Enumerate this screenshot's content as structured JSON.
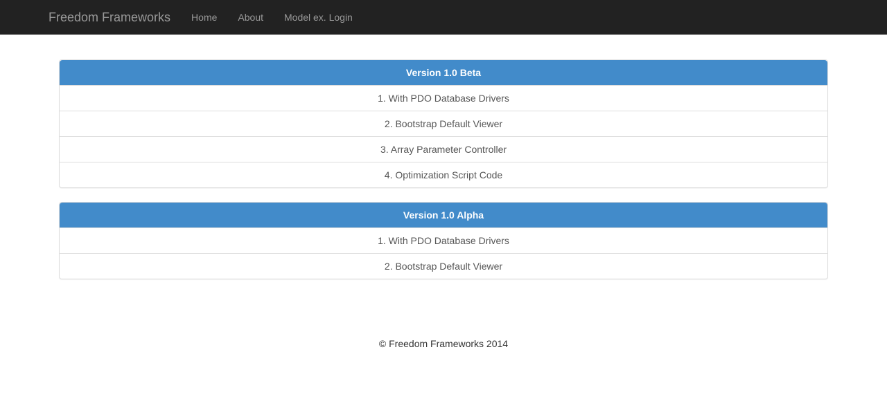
{
  "navbar": {
    "brand": "Freedom Frameworks",
    "links": [
      {
        "label": "Home"
      },
      {
        "label": "About"
      },
      {
        "label": "Model ex. Login"
      }
    ]
  },
  "panels": [
    {
      "heading": "Version 1.0 Beta",
      "items": [
        "1. With PDO Database Drivers",
        "2. Bootstrap Default Viewer",
        "3. Array Parameter Controller",
        "4. Optimization Script Code"
      ]
    },
    {
      "heading": "Version 1.0 Alpha",
      "items": [
        "1. With PDO Database Drivers",
        "2. Bootstrap Default Viewer"
      ]
    }
  ],
  "footer": {
    "text": "© Freedom Frameworks 2014"
  }
}
